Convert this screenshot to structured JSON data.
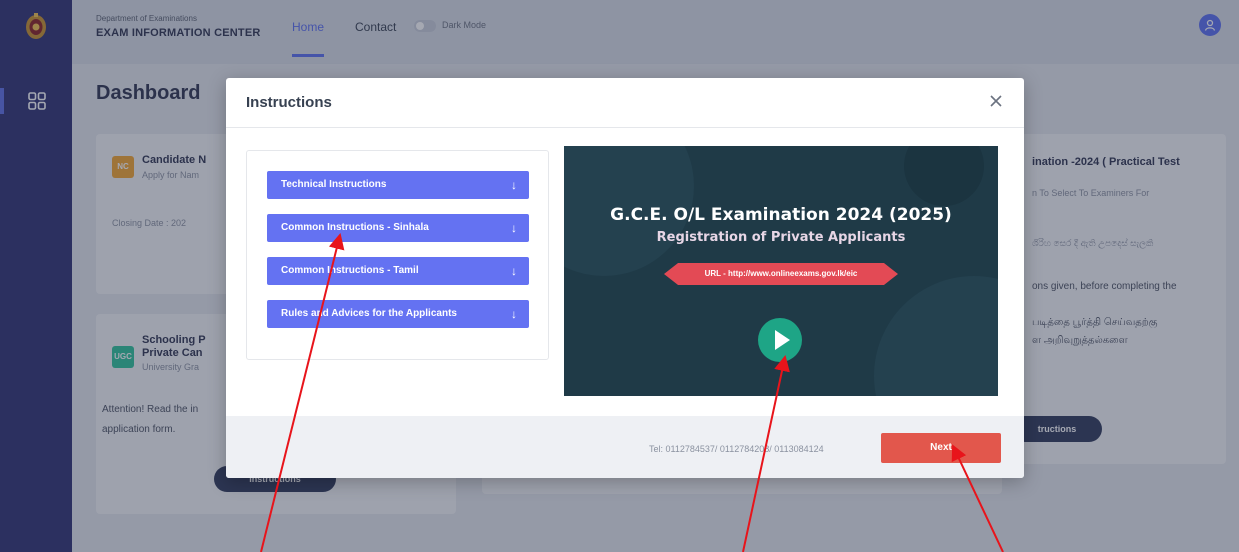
{
  "header": {
    "department": "Department of Examinations",
    "center_name": "EXAM INFORMATION CENTER",
    "nav": {
      "home": "Home",
      "contact": "Contact"
    },
    "dark_mode_label": "Dark Mode",
    "accent": "#5b6ef0"
  },
  "sidebar": {
    "items": [
      {
        "icon": "grid-icon",
        "active": true
      }
    ]
  },
  "page": {
    "title": "Dashboard"
  },
  "cards": {
    "candidate": {
      "badge": "NC",
      "title": "Candidate N",
      "subtitle": "Apply for Nam",
      "closing": "Closing Date : 202"
    },
    "schooling": {
      "badge": "UGC",
      "title_line1": "Schooling P",
      "title_line2": "Private Can",
      "subtitle": "University Gra",
      "text_line1": "Attention! Read the in",
      "text_line2": "application form.",
      "button": "Instructions"
    },
    "practical": {
      "title": "ination -2024 ( Practical Test",
      "line1": "n To Select To Examiners For",
      "line2": "ශිරිහ සෙර දී ඇති උපදෙස් සැලකි",
      "line3": "ons given, before completing the",
      "line4": "படித்தை பூர்த்தி செய்வதற்கு",
      "line5": "ள அறிவுறுத்தல்களை",
      "button": "tructions"
    }
  },
  "modal": {
    "title": "Instructions",
    "accordion": [
      {
        "label": "Technical Instructions"
      },
      {
        "label": "Common Instructions - Sinhala"
      },
      {
        "label": "Common Instructions - Tamil"
      },
      {
        "label": "Rules and Advices for the Applicants"
      }
    ],
    "video": {
      "title_line1": "G.C.E. O/L Examination 2024 (2025)",
      "title_line2": "Registration of Private Applicants",
      "url_banner": "URL - http://www.onlineexams.gov.lk/eic"
    },
    "footer": {
      "tel": "Tel: 0112784537/ 0112784208/ 0113084124",
      "next_label": "Next"
    }
  },
  "colors": {
    "rail": "#2f3173",
    "accordion": "#6472f2",
    "next_button": "#e2574c",
    "video_bg": "#1f3a47",
    "play_button": "#1ea586",
    "annotation_arrow": "#e8141b"
  }
}
